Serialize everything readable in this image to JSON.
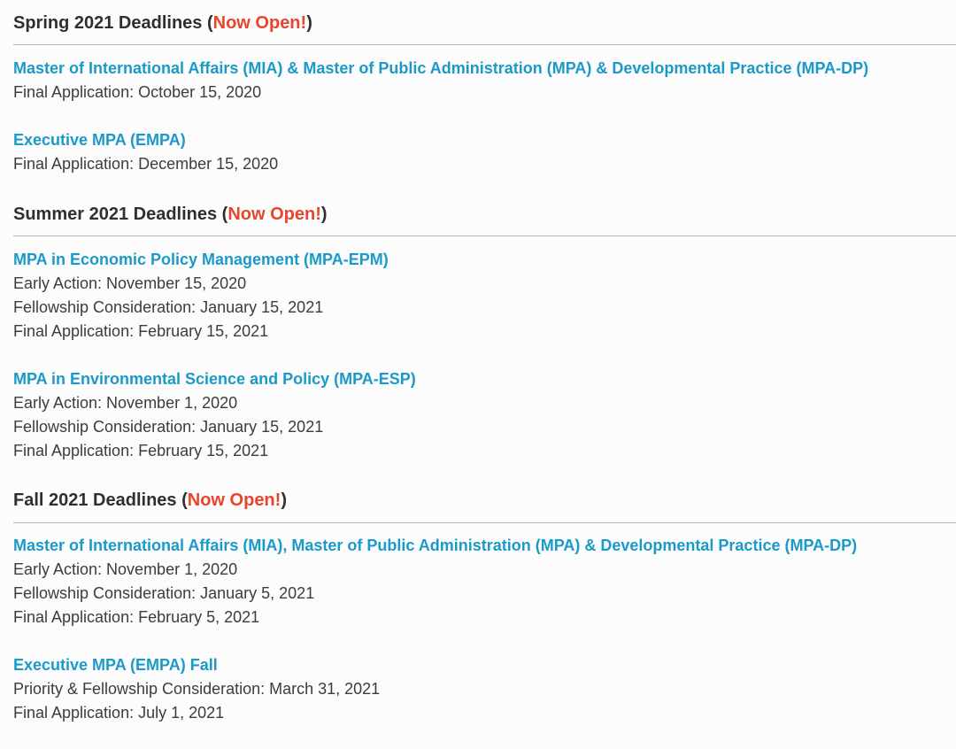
{
  "sections": [
    {
      "heading_prefix": "Spring 2021 Deadlines (",
      "heading_open": "Now Open!",
      "heading_suffix": ")",
      "programs": [
        {
          "title": "Master of International Affairs (MIA) & Master of Public Administration (MPA) & Developmental Practice (MPA-DP)",
          "lines": [
            "Final Application: October 15, 2020"
          ]
        },
        {
          "title": "Executive MPA (EMPA)",
          "lines": [
            "Final Application: December 15, 2020"
          ]
        }
      ]
    },
    {
      "heading_prefix": "Summer 2021 Deadlines (",
      "heading_open": "Now Open!",
      "heading_suffix": ")",
      "programs": [
        {
          "title": "MPA in Economic Policy Management (MPA-EPM)",
          "lines": [
            "Early Action: November 15, 2020",
            "Fellowship Consideration: January 15, 2021",
            "Final Application: February 15, 2021"
          ]
        },
        {
          "title": "MPA in Environmental Science and Policy (MPA-ESP)",
          "lines": [
            "Early Action: November 1, 2020",
            "Fellowship Consideration: January 15, 2021",
            "Final Application: February 15, 2021"
          ]
        }
      ]
    },
    {
      "heading_prefix": "Fall 2021 Deadlines (",
      "heading_open": "Now Open!",
      "heading_suffix": ")",
      "programs": [
        {
          "title": "Master of International Affairs (MIA), Master of Public Administration (MPA) & Developmental Practice (MPA-DP)",
          "lines": [
            "Early Action: November 1, 2020",
            "Fellowship Consideration: January 5, 2021",
            "Final Application: February 5, 2021"
          ]
        },
        {
          "title": "Executive MPA (EMPA) Fall",
          "lines": [
            "Priority & Fellowship Consideration: March 31, 2021",
            "Final Application: July 1, 2021"
          ]
        }
      ]
    }
  ]
}
